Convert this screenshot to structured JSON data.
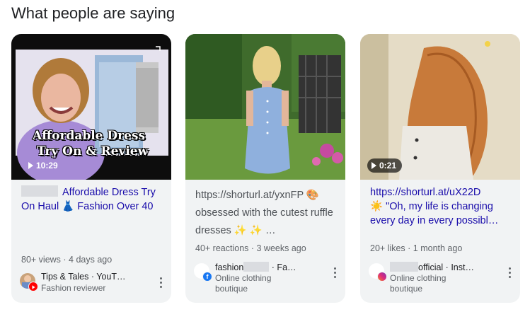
{
  "section": {
    "heading": "What people are saying"
  },
  "cards": [
    {
      "thumbnail_caption_line1": "Affordable Dress",
      "thumbnail_caption_line2": "Try On & Review",
      "duration": "10:29",
      "title": "Affordable Dress Try On Haul 👗 Fashion Over 40",
      "meta": "80+ views · 4 days ago",
      "source_name": "Tips & Tales · YouT…",
      "source_sub": "Fashion reviewer",
      "source_platform_icon": "youtube-icon"
    },
    {
      "url": "https://shorturl.at/yxnFP 🎨",
      "snippet": "obsessed with the cutest ruffle dresses ✨ ✨ …",
      "meta": "40+ reactions · 3 weeks ago",
      "source_name_start": "fashion",
      "source_name_end": "· Fa…",
      "source_sub": "Online clothing boutique",
      "source_platform_icon": "facebook-icon"
    },
    {
      "duration": "0:21",
      "url": "https://shorturl.at/uX22D",
      "snippet": "☀️ \"Oh, my life is changing every day in every possibl…",
      "meta": "20+ likes · 1 month ago",
      "source_name_start": "official · Inst…",
      "source_sub": "Online clothing boutique",
      "source_platform_icon": "instagram-icon"
    }
  ],
  "colors": {
    "link": "#1a0dab",
    "card_bg": "#f1f3f4",
    "meta": "#5f6368"
  }
}
